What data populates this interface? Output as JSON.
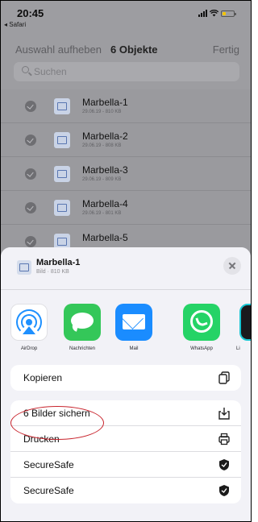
{
  "status": {
    "time": "20:45",
    "back_app": "◂ Safari",
    "battery_color": "#f3c400"
  },
  "topbar": {
    "deselect_label": "Auswahl aufheben",
    "count_label": "6 Objekte",
    "done_label": "Fertig"
  },
  "search": {
    "placeholder": "Suchen"
  },
  "files": [
    {
      "name": "Marbella-1",
      "meta": "29.06.19 - 810 KB",
      "selected": true
    },
    {
      "name": "Marbella-2",
      "meta": "29.06.19 - 808 KB",
      "selected": true
    },
    {
      "name": "Marbella-3",
      "meta": "29.06.19 - 809 KB",
      "selected": true
    },
    {
      "name": "Marbella-4",
      "meta": "29.06.19 - 801 KB",
      "selected": true
    },
    {
      "name": "Marbella-5",
      "meta": "",
      "selected": true
    }
  ],
  "share_sheet": {
    "title": "Marbella-1",
    "subtitle": "Bild · 810 KB",
    "apps": [
      {
        "label": "AirDrop",
        "icon": "airdrop-icon",
        "color": "#1e90ff"
      },
      {
        "label": "Nachrichten",
        "icon": "messages-icon",
        "color": "#34c759"
      },
      {
        "label": "Mail",
        "icon": "mail-icon",
        "color": "#1a8cff"
      },
      {
        "label": "WhatsApp",
        "icon": "whatsapp-icon",
        "color": "#25d366"
      },
      {
        "label": "Li",
        "icon": "partial-app-icon",
        "color": "#19c7d4"
      }
    ],
    "actions_group1": [
      {
        "label": "Kopieren",
        "icon": "copy-icon"
      }
    ],
    "actions_group2": [
      {
        "label": "6 Bilder sichern",
        "icon": "save-images-icon",
        "highlighted": true
      },
      {
        "label": "Drucken",
        "icon": "print-icon"
      },
      {
        "label": "SecureSafe",
        "icon": "securesafe-icon"
      },
      {
        "label": "SecureSafe",
        "icon": "securesafe-icon"
      }
    ],
    "highlight_color": "#c8232c"
  }
}
